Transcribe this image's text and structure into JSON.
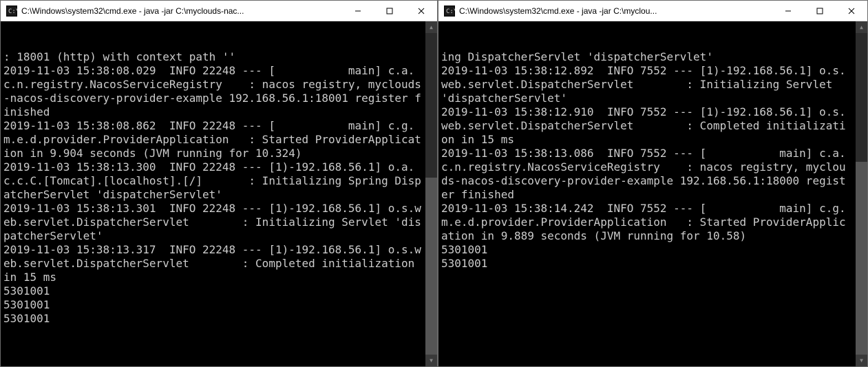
{
  "windows": [
    {
      "title": "C:\\Windows\\system32\\cmd.exe - java  -jar C:\\myclouds-nac...",
      "terminal_lines": [
        ": 18001 (http) with context path ''",
        "2019-11-03 15:38:08.029  INFO 22248 --- [           main] c.a.c.n.registry.NacosServiceRegistry    : nacos registry, myclouds-nacos-discovery-provider-example 192.168.56.1:18001 register finished",
        "2019-11-03 15:38:08.862  INFO 22248 --- [           main] c.g.m.e.d.provider.ProviderApplication   : Started ProviderApplication in 9.904 seconds (JVM running for 10.324)",
        "2019-11-03 15:38:13.300  INFO 22248 --- [1)-192.168.56.1] o.a.c.c.C.[Tomcat].[localhost].[/]       : Initializing Spring DispatcherServlet 'dispatcherServlet'",
        "2019-11-03 15:38:13.301  INFO 22248 --- [1)-192.168.56.1] o.s.web.servlet.DispatcherServlet        : Initializing Servlet 'dispatcherServlet'",
        "2019-11-03 15:38:13.317  INFO 22248 --- [1)-192.168.56.1] o.s.web.servlet.DispatcherServlet        : Completed initialization in 15 ms",
        "5301001",
        "5301001",
        "5301001"
      ]
    },
    {
      "title": "C:\\Windows\\system32\\cmd.exe - java  -jar C:\\myclou...",
      "terminal_lines": [
        "ing DispatcherServlet 'dispatcherServlet'",
        "2019-11-03 15:38:12.892  INFO 7552 --- [1)-192.168.56.1] o.s.web.servlet.DispatcherServlet        : Initializing Servlet 'dispatcherServlet'",
        "2019-11-03 15:38:12.910  INFO 7552 --- [1)-192.168.56.1] o.s.web.servlet.DispatcherServlet        : Completed initialization in 15 ms",
        "2019-11-03 15:38:13.086  INFO 7552 --- [           main] c.a.c.n.registry.NacosServiceRegistry    : nacos registry, myclouds-nacos-discovery-provider-example 192.168.56.1:18000 register finished",
        "2019-11-03 15:38:14.242  INFO 7552 --- [           main] c.g.m.e.d.provider.ProviderApplication   : Started ProviderApplication in 9.889 seconds (JVM running for 10.58)",
        "5301001",
        "5301001"
      ]
    }
  ],
  "controls": {
    "minimize": "—",
    "maximize": "□",
    "close": "✕"
  }
}
